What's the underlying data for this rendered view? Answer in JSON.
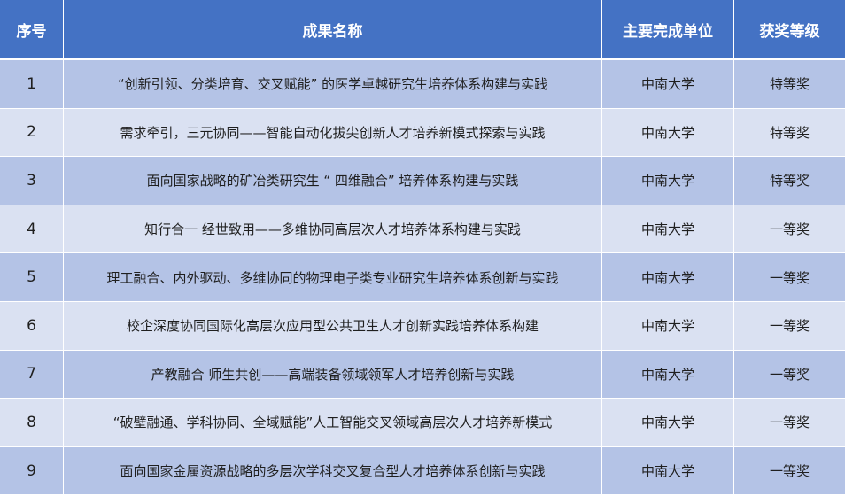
{
  "colors": {
    "header_bg": "#4472c4",
    "row_odd_bg": "#b4c3e6",
    "row_even_bg": "#dae1f2"
  },
  "header": {
    "index": "序号",
    "name": "成果名称",
    "unit": "主要完成单位",
    "level": "获奖等级"
  },
  "rows": [
    {
      "index": "1",
      "name": "“创新引领、分类培育、交叉赋能” 的医学卓越研究生培养体系构建与实践",
      "unit": "中南大学",
      "level": "特等奖"
    },
    {
      "index": "2",
      "name": "需求牵引，三元协同——智能自动化拔尖创新人才培养新模式探索与实践",
      "unit": "中南大学",
      "level": "特等奖"
    },
    {
      "index": "3",
      "name": "面向国家战略的矿冶类研究生 “ 四维融合” 培养体系构建与实践",
      "unit": "中南大学",
      "level": "特等奖"
    },
    {
      "index": "4",
      "name": "知行合一 经世致用——多维协同高层次人才培养体系构建与实践",
      "unit": "中南大学",
      "level": "一等奖"
    },
    {
      "index": "5",
      "name": "理工融合、内外驱动、多维协同的物理电子类专业研究生培养体系创新与实践",
      "unit": "中南大学",
      "level": "一等奖"
    },
    {
      "index": "6",
      "name": "校企深度协同国际化高层次应用型公共卫生人才创新实践培养体系构建",
      "unit": "中南大学",
      "level": "一等奖"
    },
    {
      "index": "7",
      "name": "产教融合 师生共创——高端装备领域领军人才培养创新与实践",
      "unit": "中南大学",
      "level": "一等奖"
    },
    {
      "index": "8",
      "name": "“破壁融通、学科协同、全域赋能”人工智能交叉领域高层次人才培养新模式",
      "unit": "中南大学",
      "level": "一等奖"
    },
    {
      "index": "9",
      "name": "面向国家金属资源战略的多层次学科交叉复合型人才培养体系创新与实践",
      "unit": "中南大学",
      "level": "一等奖"
    }
  ]
}
